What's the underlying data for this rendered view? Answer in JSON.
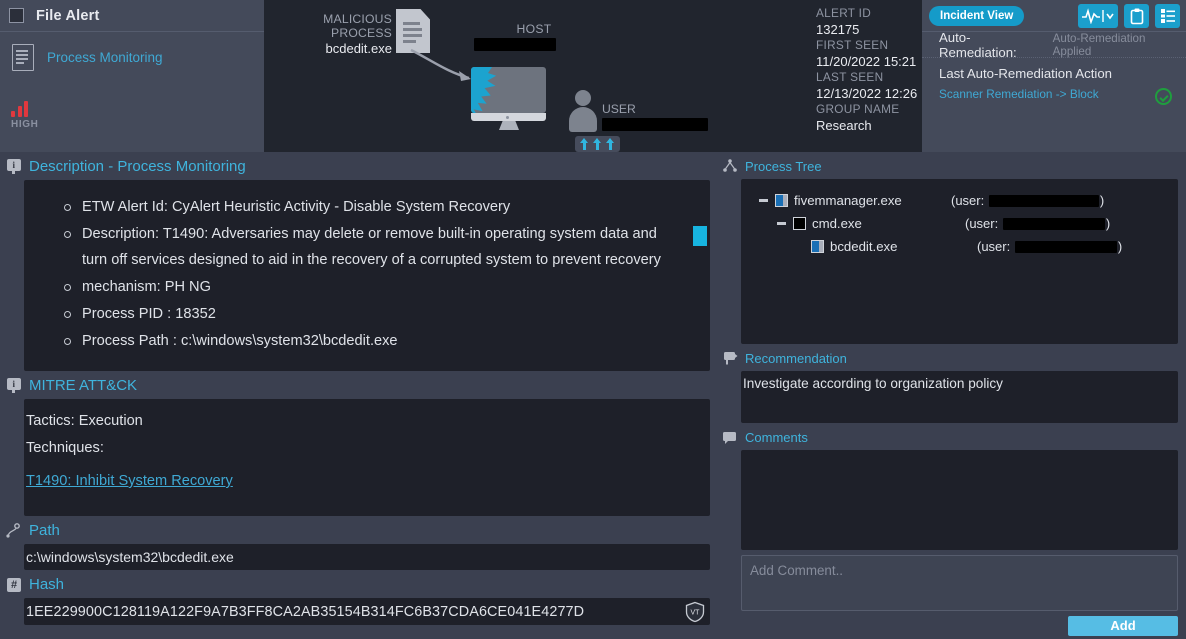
{
  "alert": {
    "title": "File Alert",
    "category_link": "Process Monitoring",
    "severity": "HIGH",
    "severity_color": "#e0383e"
  },
  "diagram": {
    "malicious_process_caption": "MALICIOUS PROCESS",
    "malicious_process_name": "bcdedit.exe",
    "host_caption": "HOST",
    "host_name_redacted": true,
    "user_caption": "USER",
    "user_name_redacted": true
  },
  "alert_info": {
    "alert_id_label": "ALERT ID",
    "alert_id": "132175",
    "first_seen_label": "FIRST SEEN",
    "first_seen": "11/20/2022 15:21",
    "last_seen_label": "LAST SEEN",
    "last_seen": "12/13/2022 12:26",
    "group_name_label": "GROUP NAME",
    "group_name": "Research"
  },
  "incident": {
    "view_button": "Incident View",
    "icons": [
      "activity-pulse-icon",
      "clipboard-icon",
      "list-settings-icon"
    ],
    "auto_remediation_label": "Auto-Remediation:",
    "auto_remediation_value": "Auto-Remediation Applied",
    "last_action_title": "Last Auto-Remediation Action",
    "last_action_value": "Scanner Remediation -> Block",
    "status_color": "#1f9e3e"
  },
  "description": {
    "heading": "Description - Process Monitoring",
    "items": [
      "ETW Alert Id: CyAlert Heuristic Activity - Disable System Recovery",
      "Description: T1490: Adversaries may delete or remove built-in operating system data and turn off services designed to aid in the recovery of a corrupted system to prevent recovery",
      "mechanism: PH NG",
      "Process PID : 18352",
      "Process Path : c:\\windows\\system32\\bcdedit.exe"
    ]
  },
  "mitre": {
    "heading": "MITRE ATT&CK",
    "tactics": "Tactics: Execution",
    "techniques_label": "Techniques:",
    "technique_link": "T1490: Inhibit System Recovery"
  },
  "path": {
    "heading": "Path",
    "value": "c:\\windows\\system32\\bcdedit.exe"
  },
  "hash": {
    "heading": "Hash",
    "value": "1EE229900C128119A122F9A7B3FF8CA2AB35154B314FC6B37CDA6CE041E4277D",
    "lookup_icon": "virustotal-shield-icon"
  },
  "process_tree": {
    "heading": "Process Tree",
    "nodes": [
      {
        "name": "fivemmanager.exe",
        "user_label": "(user:",
        "user_redacted": true,
        "icon": "blue-window-icon",
        "depth": 0
      },
      {
        "name": "cmd.exe",
        "user_label": "(user:",
        "user_redacted": true,
        "icon": "black-console-icon",
        "depth": 1
      },
      {
        "name": "bcdedit.exe",
        "user_label": "(user:",
        "user_redacted": true,
        "icon": "blue-window-icon",
        "depth": 2
      }
    ]
  },
  "recommendation": {
    "heading": "Recommendation",
    "text": "Investigate according to organization policy"
  },
  "comments": {
    "heading": "Comments",
    "placeholder": "Add Comment..",
    "value": "",
    "add_button": "Add"
  }
}
